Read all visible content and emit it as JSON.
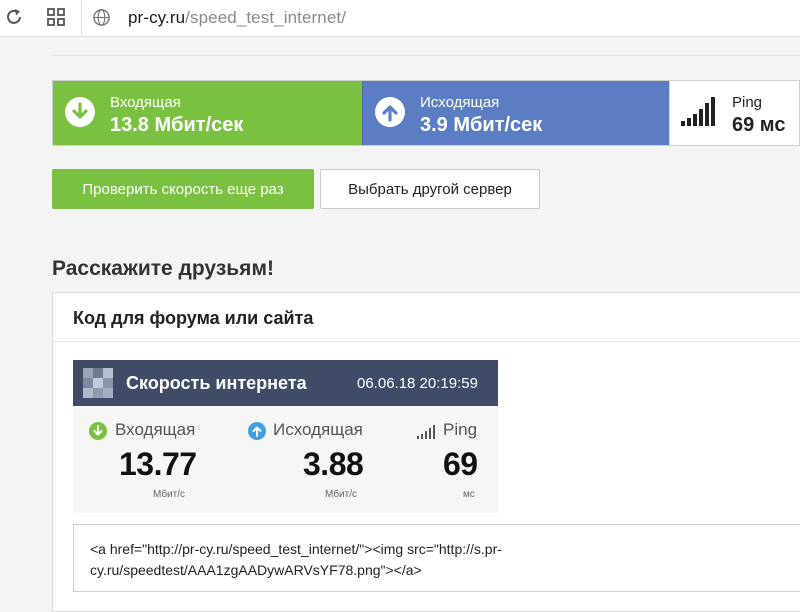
{
  "browser": {
    "url_domain": "pr-cy.ru",
    "url_path": "/speed_test_internet/"
  },
  "results": {
    "download": {
      "label": "Входящая",
      "value": "13.8 Мбит/сек",
      "color": "#7ac142",
      "icon": "arrow-down-circle-icon"
    },
    "upload": {
      "label": "Исходящая",
      "value": "3.9 Мбит/сек",
      "color": "#5b7dc4",
      "icon": "arrow-up-circle-icon"
    },
    "ping": {
      "label": "Ping",
      "value": "69 мс",
      "icon": "signal-bars-icon"
    }
  },
  "buttons": {
    "recheck": "Проверить скорость еще раз",
    "change_server": "Выбрать другой сервер"
  },
  "share": {
    "heading": "Расскажите друзьям!",
    "card_title": "Код для форума или сайта",
    "widget": {
      "title": "Скорость интернета",
      "datetime": "06.06.18 20:19:59",
      "download": {
        "label": "Входящая",
        "value": "13.77",
        "unit": "Мбит/с"
      },
      "upload": {
        "label": "Исходящая",
        "value": "3.88",
        "unit": "Мбит/с"
      },
      "ping": {
        "label": "Ping",
        "value": "69",
        "unit": "мс"
      },
      "header_color": "#3f4b67"
    },
    "code": "<a href=\"http://pr-cy.ru/speed_test_internet/\"><img src=\"http://s.pr-\ncy.ru/speedtest/AAA1zgAADywARVsYF78.png\"></a>"
  }
}
